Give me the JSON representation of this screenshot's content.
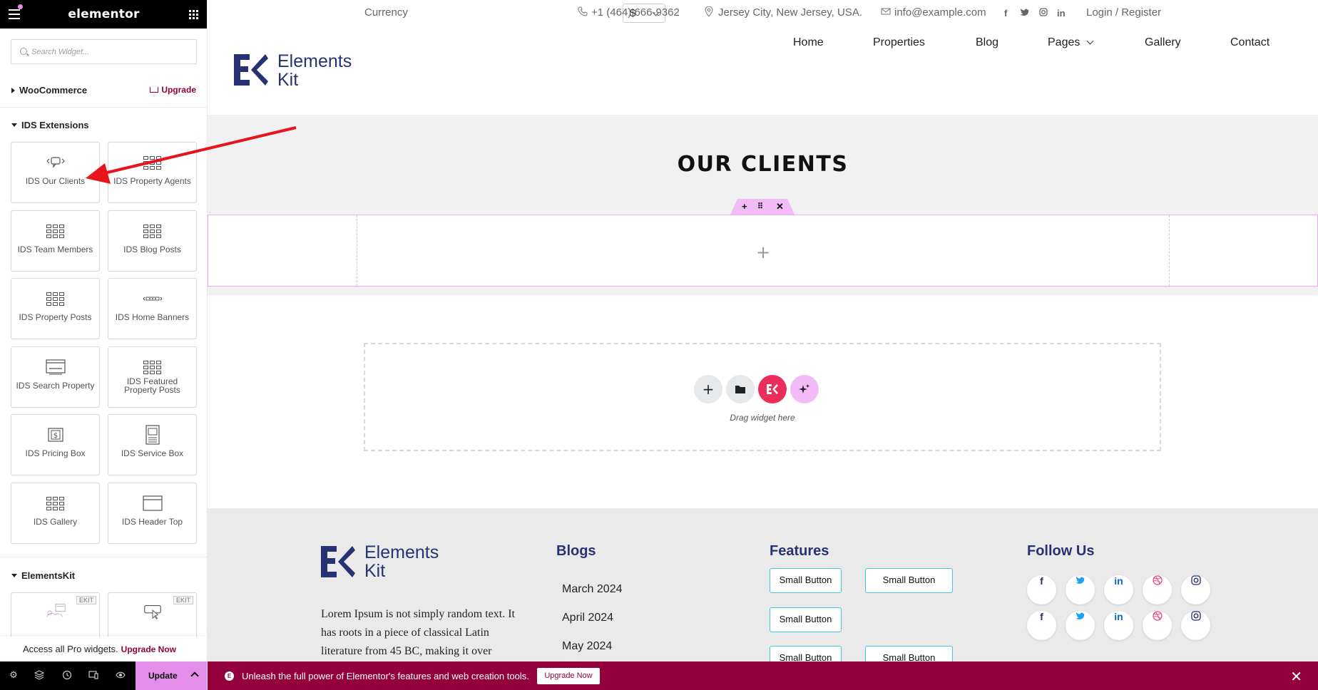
{
  "panel": {
    "brand": "elementor",
    "search_placeholder": "Search Widget...",
    "woocommerce_label": "WooCommerce",
    "upgrade_label": "Upgrade",
    "ids_category": "IDS Extensions",
    "elementskit_category": "ElementsKit",
    "ekit_badge": "EKIT",
    "widgets": [
      {
        "label": "IDS Our Clients",
        "icon": "speech-bubble-icon"
      },
      {
        "label": "IDS Property Agents",
        "icon": "grid-icon"
      },
      {
        "label": "IDS Team Members",
        "icon": "grid-icon"
      },
      {
        "label": "IDS Blog Posts",
        "icon": "grid-icon"
      },
      {
        "label": "IDS Property Posts",
        "icon": "grid-icon"
      },
      {
        "label": "IDS Home Banners",
        "icon": "slider-icon"
      },
      {
        "label": "IDS Search Property",
        "icon": "browser-icon"
      },
      {
        "label": "IDS Featured Property Posts",
        "icon": "grid-icon"
      },
      {
        "label": "IDS Pricing Box",
        "icon": "price-box-icon"
      },
      {
        "label": "IDS Service Box",
        "icon": "service-box-icon"
      },
      {
        "label": "IDS Gallery",
        "icon": "grid-icon"
      },
      {
        "label": "IDS Header Top",
        "icon": "browser-icon"
      }
    ],
    "pro_text": "Access all Pro widgets.",
    "pro_link": "Upgrade Now",
    "update_label": "Update"
  },
  "topbar": {
    "currency_label": "Currency",
    "currency_value": "$",
    "phone": "+1 (464) 666-9362",
    "location": "Jersey City, New Jersey, USA.",
    "email": "info@example.com",
    "login": "Login / Register"
  },
  "brand": {
    "line1": "Elements",
    "line2": "Kit"
  },
  "nav": [
    "Home",
    "Properties",
    "Blog",
    "Pages",
    "Gallery",
    "Contact"
  ],
  "clients": {
    "title": "OUR CLIENTS"
  },
  "dropzone": {
    "hint": "Drag widget here"
  },
  "footer": {
    "about": "Lorem Ipsum is not simply random text. It has roots in a piece of classical Latin literature from 45 BC, making it over",
    "blogs_title": "Blogs",
    "blogs": [
      "March 2024",
      "April 2024",
      "May 2024"
    ],
    "features_title": "Features",
    "feature_button": "Small Button",
    "follow_title": "Follow Us"
  },
  "promo": {
    "text": "Unleash the full power of Elementor's features and web creation tools.",
    "button": "Upgrade Now"
  },
  "colors": {
    "accent": "#93003c",
    "pink": "#e38ee8",
    "navy": "#273272",
    "arrow": "#e8141b"
  }
}
